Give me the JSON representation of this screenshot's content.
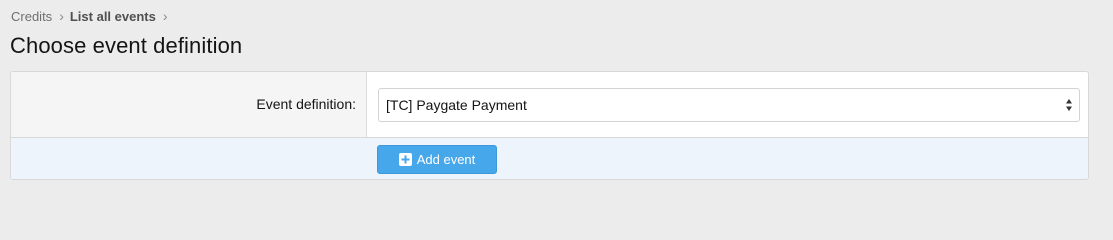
{
  "breadcrumb": {
    "items": [
      {
        "label": "Credits"
      },
      {
        "label": "List all events"
      }
    ]
  },
  "page": {
    "title": "Choose event definition"
  },
  "form": {
    "event_definition": {
      "label": "Event definition:",
      "selected": "[TC] Paygate Payment"
    },
    "submit": {
      "label": "Add event",
      "icon": "plus-square-icon"
    }
  },
  "colors": {
    "accent": "#47a7eb",
    "footer_background": "#edf4fc",
    "page_background": "#ececec"
  }
}
